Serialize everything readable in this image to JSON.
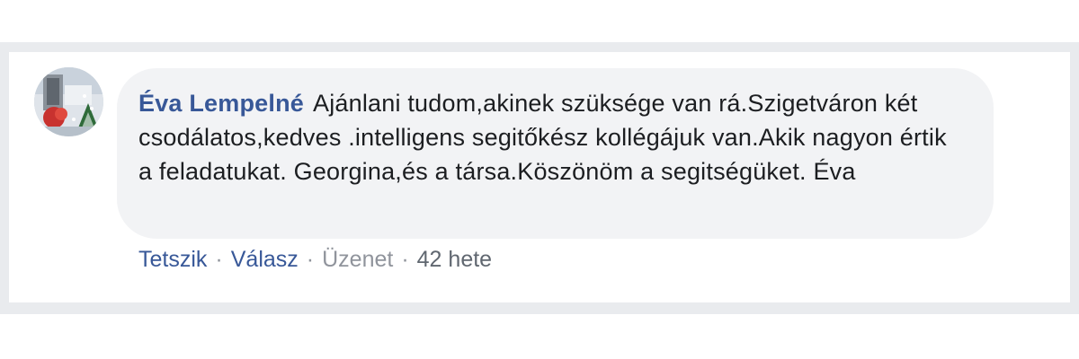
{
  "comment": {
    "author": "Éva Lempelné",
    "text": "Ajánlani tudom,akinek szüksége van rá.Szigetváron két csodálatos,kedves .intelligens segitőkész kollégájuk van.Akik nagyon értik a feladatukat. Georgina,és a társa.Köszönöm a segitségüket. Éva",
    "avatar_icon": "profile-photo"
  },
  "actions": {
    "like_label": "Tetszik",
    "reply_label": "Válasz",
    "message_label": "Üzenet",
    "separator": "·",
    "timestamp": "42 hete"
  },
  "colors": {
    "link": "#385898",
    "bubble": "#f2f3f5",
    "frame": "#e9ebee",
    "text": "#1c1e21"
  }
}
